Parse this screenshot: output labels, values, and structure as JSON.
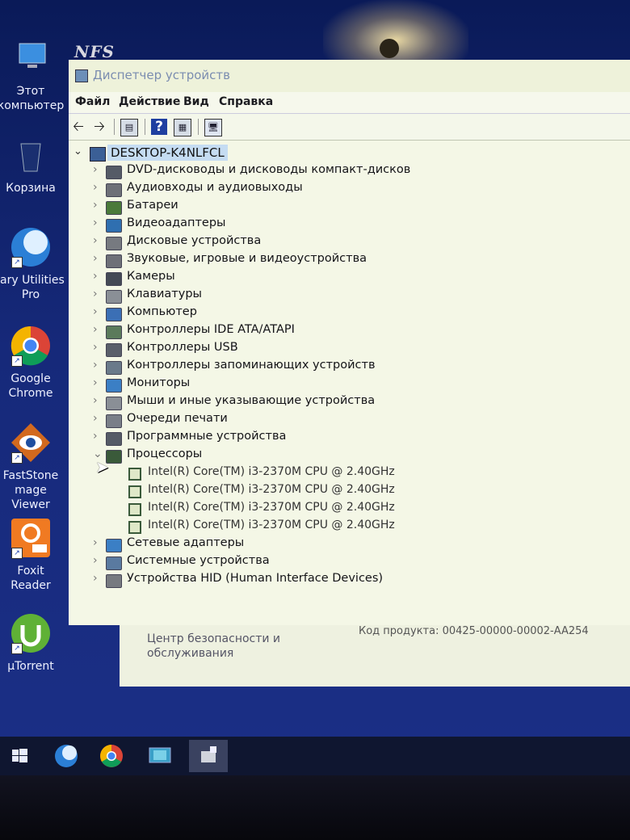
{
  "desktop": {
    "icons": [
      {
        "label": "Этот\nкомпьютер",
        "icon": "this-pc-icon"
      },
      {
        "label": "Корзина",
        "icon": "recycle-bin-icon"
      },
      {
        "label": "lary Utilities\nPro",
        "icon": "glary-utilities-icon"
      },
      {
        "label": "Google\nChrome",
        "icon": "chrome-icon"
      },
      {
        "label": "FastStone\nmage Viewer",
        "icon": "faststone-icon"
      },
      {
        "label": "Foxit Reader",
        "icon": "foxit-reader-icon"
      },
      {
        "label": "µTorrent",
        "icon": "utorrent-icon"
      }
    ]
  },
  "monitor_logo": "NFS",
  "window": {
    "title": "Диспетчер устройств",
    "menu": [
      "Файл",
      "Действие",
      "Вид",
      "Справка"
    ],
    "toolbar": [
      "back-arrow-icon",
      "forward-arrow-icon",
      "properties-icon",
      "help-icon",
      "view-icon",
      "scan-hardware-icon"
    ],
    "root": "DESKTOP-K4NLFCL",
    "categories": [
      {
        "label": "DVD-дисководы и дисководы компакт-дисков",
        "icon": "dvd-drive-icon",
        "color": "#555b66"
      },
      {
        "label": "Аудиовходы и аудиовыходы",
        "icon": "speaker-icon",
        "color": "#6e7078"
      },
      {
        "label": "Батареи",
        "icon": "battery-icon",
        "color": "#4a7a3a"
      },
      {
        "label": "Видеоадаптеры",
        "icon": "display-adapter-icon",
        "color": "#2f6fb0"
      },
      {
        "label": "Дисковые устройства",
        "icon": "disk-drive-icon",
        "color": "#777a80"
      },
      {
        "label": "Звуковые, игровые и видеоустройства",
        "icon": "sound-device-icon",
        "color": "#6e7078"
      },
      {
        "label": "Камеры",
        "icon": "camera-icon",
        "color": "#444a55"
      },
      {
        "label": "Клавиатуры",
        "icon": "keyboard-icon",
        "color": "#8a8f96"
      },
      {
        "label": "Компьютер",
        "icon": "computer-icon",
        "color": "#3b6fb5"
      },
      {
        "label": "Контроллеры IDE ATA/ATAPI",
        "icon": "ide-controller-icon",
        "color": "#5b7a5b"
      },
      {
        "label": "Контроллеры USB",
        "icon": "usb-controller-icon",
        "color": "#5a5f6a"
      },
      {
        "label": "Контроллеры запоминающих устройств",
        "icon": "storage-controller-icon",
        "color": "#6a7a8a"
      },
      {
        "label": "Мониторы",
        "icon": "monitor-icon",
        "color": "#3b7fc5"
      },
      {
        "label": "Мыши и иные указывающие устройства",
        "icon": "mouse-icon",
        "color": "#8a8f96"
      },
      {
        "label": "Очереди печати",
        "icon": "printer-icon",
        "color": "#7a7f88"
      },
      {
        "label": "Программные устройства",
        "icon": "software-device-icon",
        "color": "#555b66"
      },
      {
        "label": "Процессоры",
        "icon": "processor-icon",
        "color": "#3a5a3a",
        "expanded": true,
        "children": [
          "Intel(R) Core(TM) i3-2370M CPU @ 2.40GHz",
          "Intel(R) Core(TM) i3-2370M CPU @ 2.40GHz",
          "Intel(R) Core(TM) i3-2370M CPU @ 2.40GHz",
          "Intel(R) Core(TM) i3-2370M CPU @ 2.40GHz"
        ]
      },
      {
        "label": "Сетевые адаптеры",
        "icon": "network-adapter-icon",
        "color": "#3b7fc5"
      },
      {
        "label": "Системные устройства",
        "icon": "system-device-icon",
        "color": "#5a7aa0"
      },
      {
        "label": "Устройства HID (Human Interface Devices)",
        "icon": "hid-device-icon",
        "color": "#777a80"
      }
    ]
  },
  "background_dialog": {
    "label": "Центр безопасности и\nобслуживания",
    "product": "Код продукта:  00425-00000-00002-AA254"
  },
  "taskbar": [
    "start-icon",
    "glary-utilities-icon",
    "chrome-icon",
    "device-manager-taskbar-icon",
    "setup-taskbar-icon"
  ]
}
